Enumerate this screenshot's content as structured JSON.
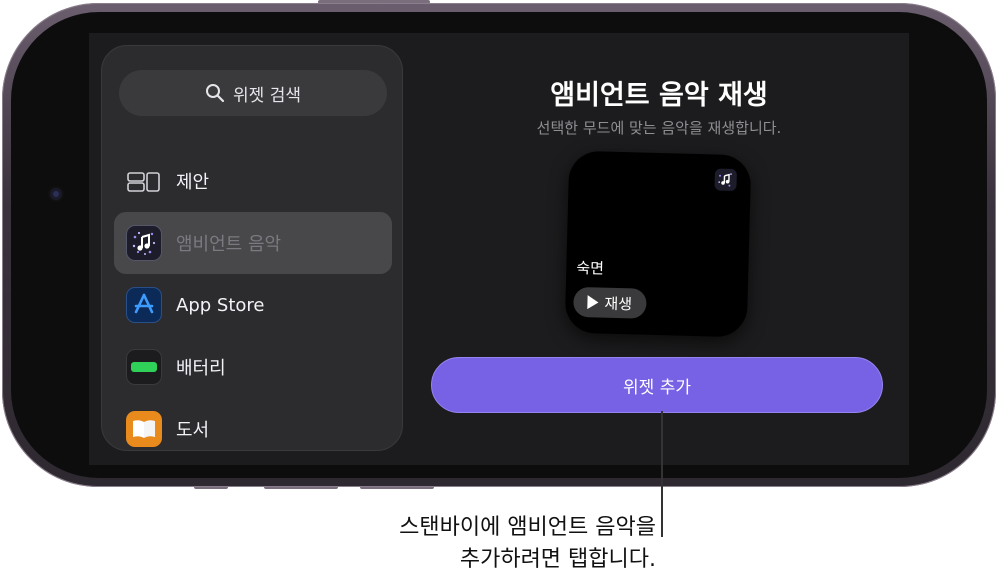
{
  "search": {
    "label": "위젯 검색"
  },
  "sidebar": {
    "items": [
      {
        "label": "제안",
        "icon": "suggestions-icon"
      },
      {
        "label": "앰비언트 음악",
        "icon": "ambient-music-icon",
        "selected": true
      },
      {
        "label": "App Store",
        "icon": "app-store-icon"
      },
      {
        "label": "배터리",
        "icon": "battery-icon"
      },
      {
        "label": "도서",
        "icon": "books-icon"
      }
    ]
  },
  "detail": {
    "title": "앰비언트 음악 재생",
    "subtitle": "선택한 무드에 맞는 음악을 재생합니다.",
    "widget": {
      "mood": "숙면",
      "play_label": "재생"
    },
    "add_button": "위젯 추가"
  },
  "callout": {
    "line1": "스탠바이에 앰비언트 음악을",
    "line2": "추가하려면 탭합니다."
  },
  "colors": {
    "accent": "#7762e6",
    "panel": "#2c2c2e",
    "screen": "#1c1c1e"
  }
}
